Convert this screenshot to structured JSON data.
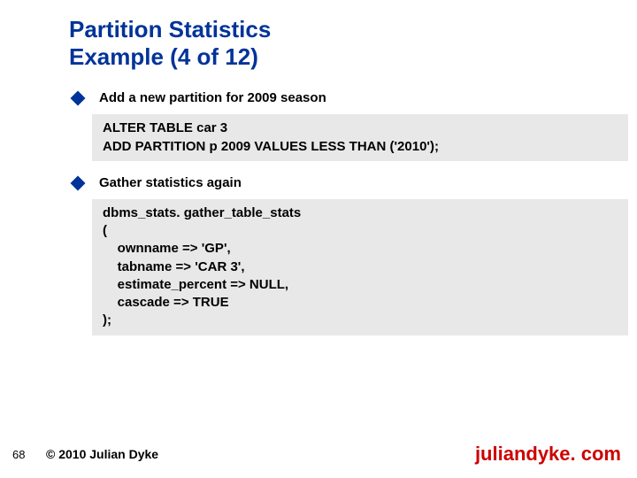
{
  "title_line1": "Partition Statistics",
  "title_line2": "Example (4 of 12)",
  "bullets": {
    "b1": "Add a new partition for 2009 season",
    "b2": "Gather statistics again"
  },
  "code": {
    "c1": "ALTER TABLE car 3\nADD PARTITION p 2009 VALUES LESS THAN ('2010');",
    "c2": "dbms_stats. gather_table_stats\n(\n    ownname => 'GP',\n    tabname => 'CAR 3',\n    estimate_percent => NULL,\n    cascade => TRUE\n);"
  },
  "footer": {
    "page": "68",
    "copyright": "© 2010 Julian Dyke",
    "site": "juliandyke. com"
  }
}
